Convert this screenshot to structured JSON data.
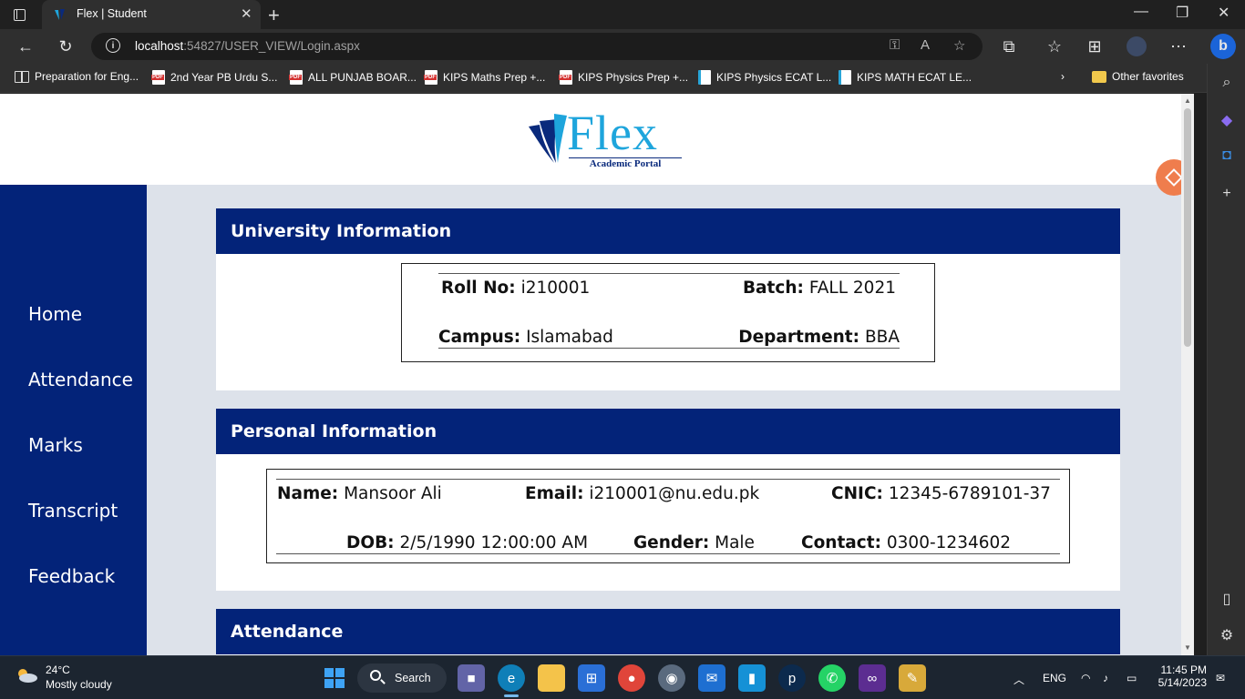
{
  "browser": {
    "tab_title": "Flex | Student",
    "url_host": "localhost",
    "url_rest": ":54827/USER_VIEW/Login.aspx",
    "favorites": [
      {
        "label": "Preparation for Eng...",
        "icon": "book-icon"
      },
      {
        "label": "2nd Year PB Urdu S...",
        "icon": "pdf-icon"
      },
      {
        "label": "ALL PUNJAB BOAR...",
        "icon": "pdf-icon"
      },
      {
        "label": "KIPS Maths Prep +...",
        "icon": "pdf-icon"
      },
      {
        "label": "KIPS Physics Prep +...",
        "icon": "pdf-icon"
      },
      {
        "label": "KIPS Physics ECAT L...",
        "icon": "doc-icon"
      },
      {
        "label": "KIPS MATH ECAT LE...",
        "icon": "doc-icon"
      }
    ],
    "other_favorites": "Other favorites"
  },
  "site": {
    "logo_word": "Flex",
    "logo_tagline": "Academic Portal"
  },
  "nav": {
    "items": [
      "Home",
      "Attendance",
      "Marks",
      "Transcript",
      "Feedback"
    ]
  },
  "university": {
    "heading": "University Information",
    "roll_label": "Roll No:",
    "roll_value": "i210001",
    "batch_label": "Batch:",
    "batch_value": "FALL 2021",
    "campus_label": "Campus:",
    "campus_value": "Islamabad",
    "department_label": "Department:",
    "department_value": "BBA"
  },
  "personal": {
    "heading": "Personal Information",
    "name_label": "Name:",
    "name_value": "Mansoor Ali",
    "email_label": "Email:",
    "email_value": "i210001@nu.edu.pk",
    "cnic_label": "CNIC:",
    "cnic_value": "12345-6789101-37",
    "dob_label": "DOB:",
    "dob_value": "2/5/1990 12:00:00 AM",
    "gender_label": "Gender:",
    "gender_value": "Male",
    "contact_label": "Contact:",
    "contact_value": "0300-1234602"
  },
  "attendance": {
    "heading": "Attendance"
  },
  "taskbar": {
    "temperature": "24°C",
    "weather": "Mostly cloudy",
    "search_label": "Search",
    "language": "ENG",
    "time": "11:45 PM",
    "date": "5/14/2023"
  },
  "colors": {
    "navy": "#032379",
    "page_bg": "#dde2ea",
    "logo_blue": "#1ea5dc"
  }
}
